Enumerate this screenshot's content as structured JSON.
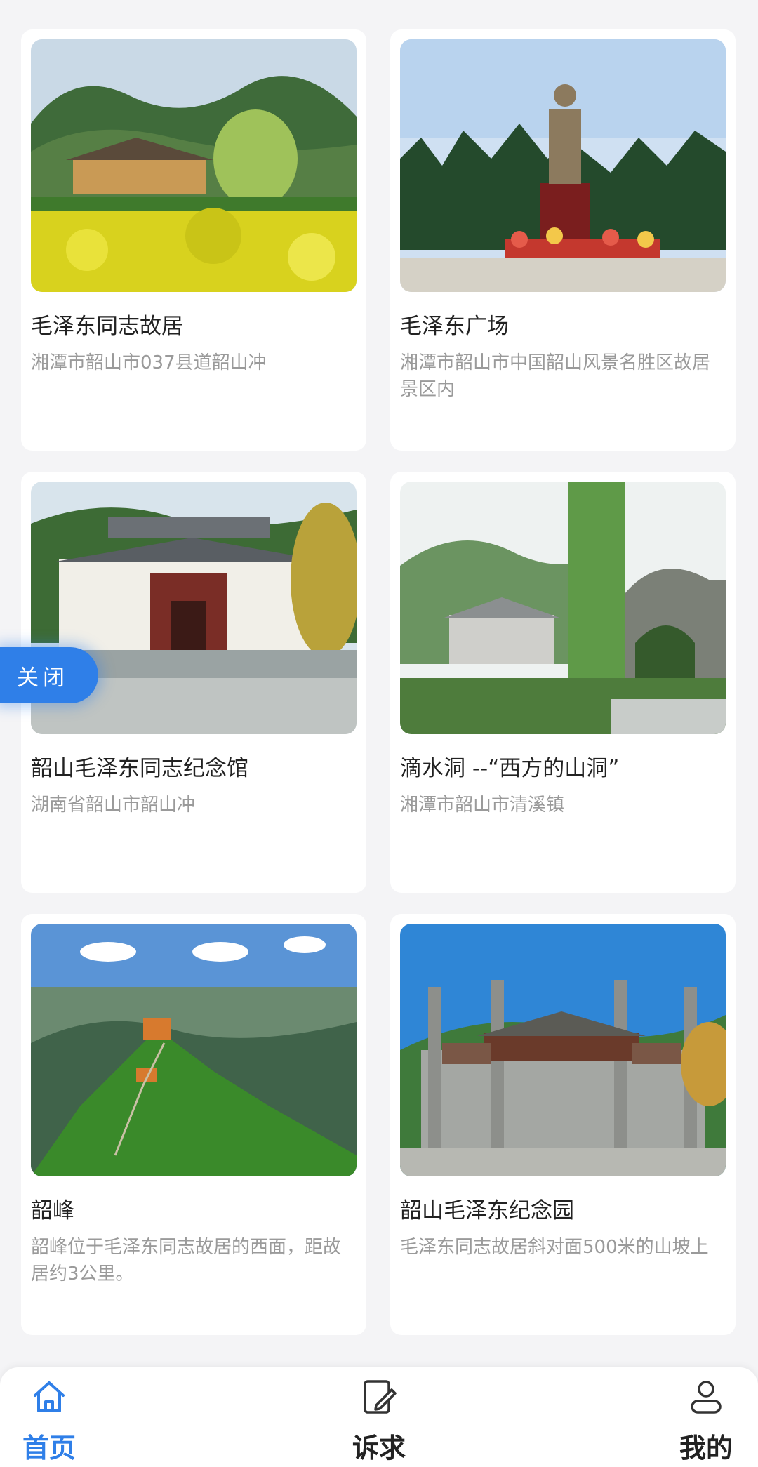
{
  "cards": [
    {
      "title": "毛泽东同志故居",
      "address": "湘潭市韶山市037县道韶山冲"
    },
    {
      "title": "毛泽东广场",
      "address": "湘潭市韶山市中国韶山风景名胜区故居景区内"
    },
    {
      "title": "韶山毛泽东同志纪念馆",
      "address": "湖南省韶山市韶山冲"
    },
    {
      "title": "滴水洞 --“西方的山洞”",
      "address": "湘潭市韶山市清溪镇"
    },
    {
      "title": "韶峰",
      "address": "韶峰位于毛泽东同志故居的西面，距故居约3公里。"
    },
    {
      "title": "韶山毛泽东纪念园",
      "address": "毛泽东同志故居斜对面500米的山坡上"
    }
  ],
  "close_label": "关闭",
  "tabbar": {
    "items": [
      {
        "label": "首页",
        "icon": "home-icon",
        "active": true
      },
      {
        "label": "诉求",
        "icon": "edit-document-icon",
        "active": false
      },
      {
        "label": "我的",
        "icon": "user-icon",
        "active": false
      }
    ],
    "active_color": "#2f7fe8"
  }
}
